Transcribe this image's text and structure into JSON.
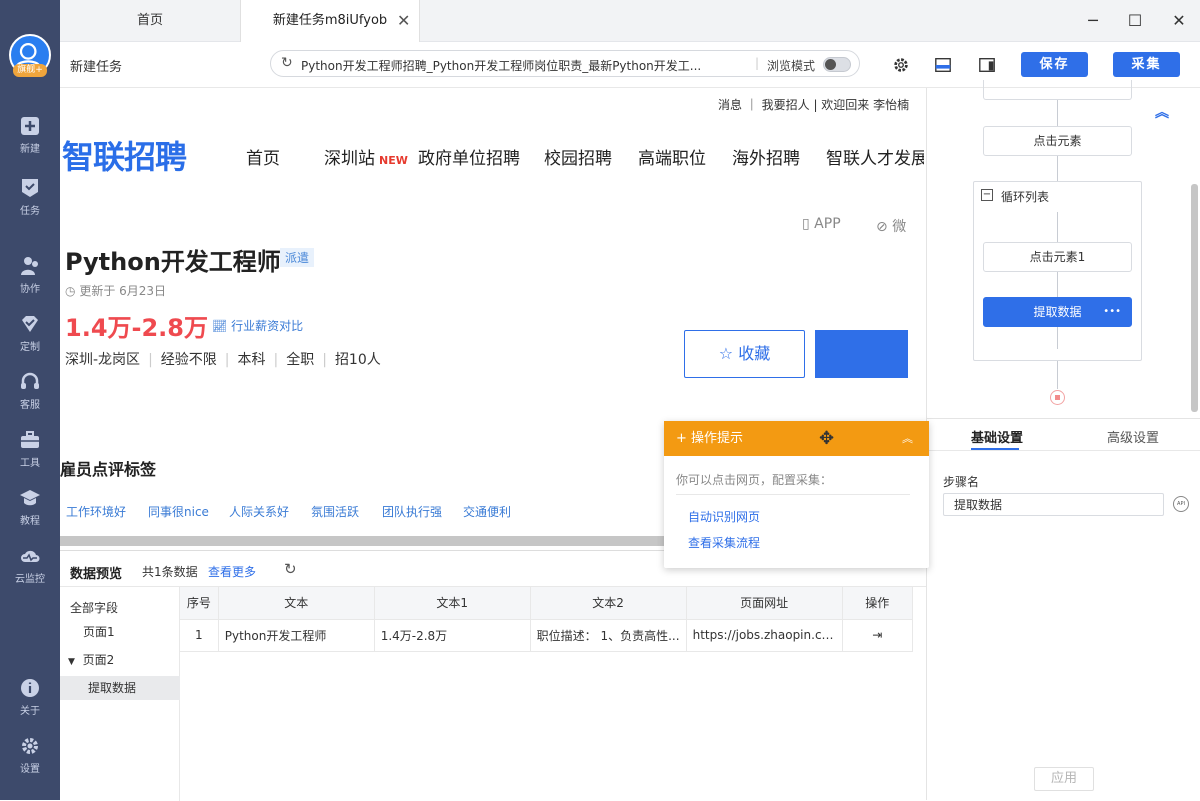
{
  "sidebar": {
    "vip_badge": "旗舰+",
    "items": [
      {
        "label": "新建",
        "icon": "plus-square-icon"
      },
      {
        "label": "任务",
        "icon": "task-flag-icon"
      },
      {
        "label": "协作",
        "icon": "people-icon"
      },
      {
        "label": "定制",
        "icon": "diamond-check-icon"
      },
      {
        "label": "客服",
        "icon": "headset-icon"
      },
      {
        "label": "工具",
        "icon": "toolbox-icon"
      },
      {
        "label": "教程",
        "icon": "graduation-cap-icon"
      },
      {
        "label": "云监控",
        "icon": "cloud-monitor-icon"
      }
    ],
    "bottom_items": [
      {
        "label": "关于",
        "icon": "info-icon"
      },
      {
        "label": "设置",
        "icon": "gear-icon"
      }
    ]
  },
  "tabs": {
    "home": "首页",
    "task": "新建任务m8iUfyob"
  },
  "toolbar": {
    "title": "新建任务",
    "url": "Python开发工程师招聘_Python开发工程师岗位职责_最新Python开发工...",
    "browse_mode": "浏览模式",
    "save": "保存",
    "collect": "采集"
  },
  "webpage": {
    "top_links": "消息 ｜ 我要招人 | 欢迎回来  李怡楠",
    "logo": "智联招聘",
    "nav": [
      "首页",
      "深圳站",
      "政府单位招聘",
      "校园招聘",
      "高端职位",
      "海外招聘",
      "智联人才发展"
    ],
    "new_badge": "NEW",
    "app_label": "APP",
    "wei_label": "微",
    "job_title": "Python开发工程师",
    "pai_tag": "派遣",
    "updated": "更新于 6月23日",
    "salary": "1.4万-2.8万",
    "compare": "行业薪资对比",
    "meta": [
      "深圳-龙岗区",
      "经验不限",
      "本科",
      "全职",
      "招10人"
    ],
    "fav": "收藏",
    "review_title": "雇员点评标签",
    "tags": [
      "工作环境好",
      "同事很nice",
      "人际关系好",
      "氛围活跃",
      "团队执行强",
      "交通便利"
    ]
  },
  "hint": {
    "title": "操作提示",
    "desc": "你可以点击网页，配置采集：",
    "link1": "自动识别网页",
    "link2": "查看采集流程"
  },
  "preview": {
    "title": "数据预览",
    "count": "共1条数据",
    "more": "查看更多",
    "fields": [
      "全部字段",
      "页面1",
      "页面2",
      "提取数据"
    ],
    "columns": [
      "序号",
      "文本",
      "文本1",
      "文本2",
      "页面网址",
      "操作"
    ],
    "rows": [
      [
        "1",
        "Python开发工程师",
        "1.4万-2.8万",
        "职位描述： 1、负责高性...",
        "https://jobs.zhaopin.com/..."
      ]
    ]
  },
  "flow": {
    "nodes": [
      "点击元素",
      "循环列表",
      "点击元素1",
      "提取数据"
    ],
    "more": "•••"
  },
  "settings": {
    "tab_basic": "基础设置",
    "tab_advanced": "高级设置",
    "step_label": "步骤名",
    "step_value": "提取数据",
    "api": "API",
    "apply": "应用"
  },
  "colors": {
    "sidebar": "#3d4a6b",
    "primary": "#2f6fe8",
    "salary": "#ef4a4f",
    "hint": "#f39a12"
  }
}
